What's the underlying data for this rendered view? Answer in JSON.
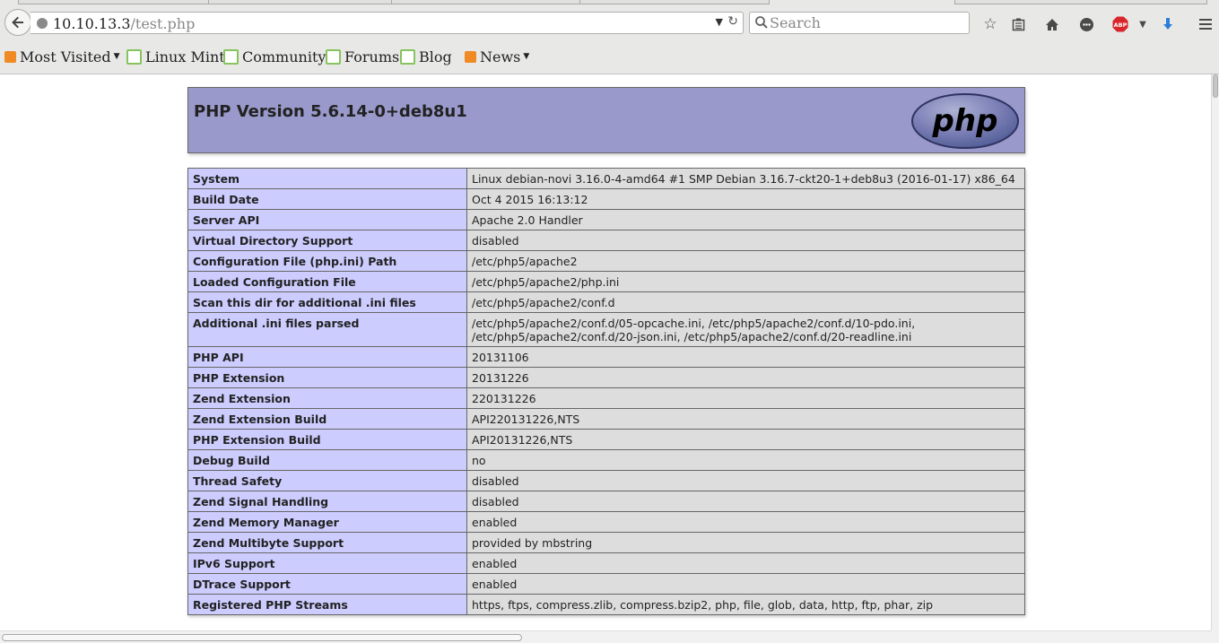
{
  "browser": {
    "url_host": "10.10.13.3",
    "url_path": "/test.php",
    "search_placeholder": "Search",
    "bookmarks": [
      {
        "label": "Most Visited",
        "icon": "most-visited-icon",
        "has_menu": true
      },
      {
        "label": "Linux Mint",
        "icon": "linux-mint-icon"
      },
      {
        "label": "Community",
        "icon": "linux-mint-icon"
      },
      {
        "label": "Forums",
        "icon": "linux-mint-icon"
      },
      {
        "label": "Blog",
        "icon": "linux-mint-icon"
      },
      {
        "label": "News",
        "icon": "rss-icon",
        "has_menu": true
      }
    ],
    "toolbar_icons": [
      "bookmark-star-icon",
      "reading-list-icon",
      "home-icon",
      "chat-icon",
      "adblock-icon",
      "download-icon",
      "menu-icon"
    ],
    "adblock_label": "ABP"
  },
  "page": {
    "title": "PHP Version 5.6.14-0+deb8u1",
    "logo_text": "php",
    "colors": {
      "header_bg": "#9999cc",
      "key_bg": "#ccccff",
      "value_bg": "#dddddd"
    },
    "rows": [
      {
        "key": "System",
        "value": "Linux debian-novi 3.16.0-4-amd64 #1 SMP Debian 3.16.7-ckt20-1+deb8u3 (2016-01-17) x86_64"
      },
      {
        "key": "Build Date",
        "value": "Oct 4 2015 16:13:12"
      },
      {
        "key": "Server API",
        "value": "Apache 2.0 Handler"
      },
      {
        "key": "Virtual Directory Support",
        "value": "disabled"
      },
      {
        "key": "Configuration File (php.ini) Path",
        "value": "/etc/php5/apache2"
      },
      {
        "key": "Loaded Configuration File",
        "value": "/etc/php5/apache2/php.ini"
      },
      {
        "key": "Scan this dir for additional .ini files",
        "value": "/etc/php5/apache2/conf.d"
      },
      {
        "key": "Additional .ini files parsed",
        "value": "/etc/php5/apache2/conf.d/05-opcache.ini, /etc/php5/apache2/conf.d/10-pdo.ini, /etc/php5/apache2/conf.d/20-json.ini, /etc/php5/apache2/conf.d/20-readline.ini"
      },
      {
        "key": "PHP API",
        "value": "20131106"
      },
      {
        "key": "PHP Extension",
        "value": "20131226"
      },
      {
        "key": "Zend Extension",
        "value": "220131226"
      },
      {
        "key": "Zend Extension Build",
        "value": "API220131226,NTS"
      },
      {
        "key": "PHP Extension Build",
        "value": "API20131226,NTS"
      },
      {
        "key": "Debug Build",
        "value": "no"
      },
      {
        "key": "Thread Safety",
        "value": "disabled"
      },
      {
        "key": "Zend Signal Handling",
        "value": "disabled"
      },
      {
        "key": "Zend Memory Manager",
        "value": "enabled"
      },
      {
        "key": "Zend Multibyte Support",
        "value": "provided by mbstring"
      },
      {
        "key": "IPv6 Support",
        "value": "enabled"
      },
      {
        "key": "DTrace Support",
        "value": "enabled"
      },
      {
        "key": "Registered PHP Streams",
        "value": "https, ftps, compress.zlib, compress.bzip2, php, file, glob, data, http, ftp, phar, zip"
      }
    ]
  }
}
